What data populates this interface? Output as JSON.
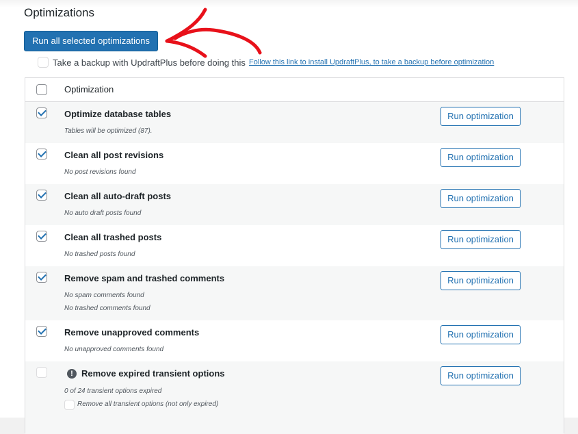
{
  "section": {
    "title": "Optimizations"
  },
  "run_all_button": "Run all selected optimizations",
  "backup": {
    "label": "Take a backup with UpdraftPlus before doing this",
    "link": "Follow this link to install UpdraftPlus, to take a backup before optimization",
    "checked": false
  },
  "table": {
    "header": "Optimization",
    "rows": [
      {
        "name": "Optimize database tables",
        "checked": true,
        "info": [
          "Tables will be optimized (87)."
        ],
        "button": "Run optimization"
      },
      {
        "name": "Clean all post revisions",
        "checked": true,
        "info": [
          "No post revisions found"
        ],
        "button": "Run optimization"
      },
      {
        "name": "Clean all auto-draft posts",
        "checked": true,
        "info": [
          "No auto draft posts found"
        ],
        "button": "Run optimization"
      },
      {
        "name": "Clean all trashed posts",
        "checked": true,
        "info": [
          "No trashed posts found"
        ],
        "button": "Run optimization"
      },
      {
        "name": "Remove spam and trashed comments",
        "checked": true,
        "info": [
          "No spam comments found",
          "No trashed comments found"
        ],
        "button": "Run optimization"
      },
      {
        "name": "Remove unapproved comments",
        "checked": true,
        "info": [
          "No unapproved comments found"
        ],
        "button": "Run optimization"
      },
      {
        "name": "Remove expired transient options",
        "checked": false,
        "warning_icon": "exclamation-icon",
        "info": [
          "0 of 24 transient options expired"
        ],
        "sub_option": "Remove all transient options (not only expired)",
        "button": "Run optimization"
      }
    ]
  },
  "annotation": {
    "arrow_color": "#e8111a"
  }
}
